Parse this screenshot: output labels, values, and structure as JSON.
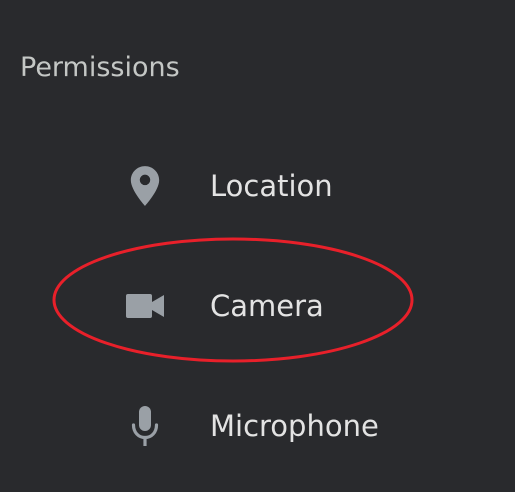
{
  "section": {
    "title": "Permissions"
  },
  "permissions": [
    {
      "label": "Location",
      "icon": "location-pin-icon"
    },
    {
      "label": "Camera",
      "icon": "videocam-icon"
    },
    {
      "label": "Microphone",
      "icon": "microphone-icon"
    }
  ],
  "colors": {
    "background": "#292a2d",
    "title_text": "#c4c7c5",
    "label_text": "#e3e3e3",
    "icon": "#9aa0a6",
    "annotation_stroke": "#e8202a"
  }
}
